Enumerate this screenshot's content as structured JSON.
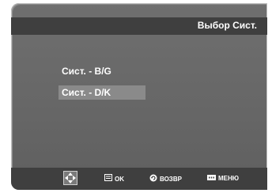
{
  "header": {
    "title": "Выбор Сист."
  },
  "menu": {
    "items": [
      {
        "label": "Сист. - B/G",
        "selected": false
      },
      {
        "label": "Сист. - D/K",
        "selected": true
      }
    ]
  },
  "footer": {
    "nav_icon": "dpad-icon",
    "ok_label": "OK",
    "ok_icon": "enter-icon",
    "back_label": "ВОЗВР",
    "back_icon": "return-icon",
    "menu_label": "МЕНЮ",
    "menu_icon": "menu-icon"
  },
  "colors": {
    "screen_bg": "#666666",
    "bar_bg": "#3f3f3f",
    "highlight_bg": "#8a8a8a",
    "text": "#ffffff"
  }
}
